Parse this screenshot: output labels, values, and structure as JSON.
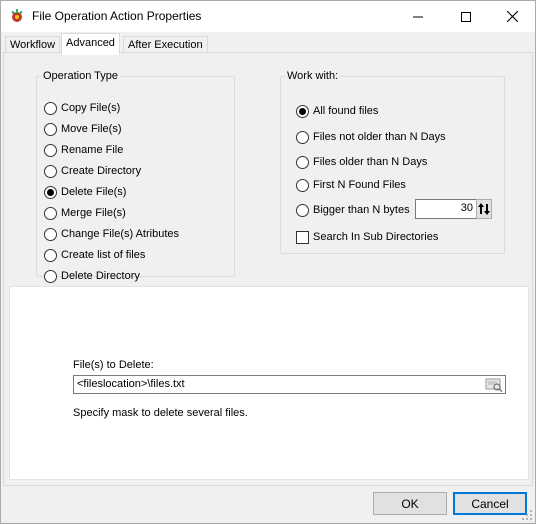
{
  "window": {
    "title": "File Operation Action Properties",
    "controls": {
      "minimize_icon": "minimize-icon",
      "maximize_icon": "maximize-icon",
      "close_icon": "close-icon"
    }
  },
  "tabs": [
    {
      "label": "Workflow",
      "active": false
    },
    {
      "label": "Advanced",
      "active": true
    },
    {
      "label": "After Execution",
      "active": false
    }
  ],
  "operation_type": {
    "legend": "Operation Type",
    "options": [
      {
        "label": "Copy File(s)",
        "checked": false
      },
      {
        "label": "Move File(s)",
        "checked": false
      },
      {
        "label": "Rename File",
        "checked": false
      },
      {
        "label": "Create Directory",
        "checked": false
      },
      {
        "label": "Delete File(s)",
        "checked": true
      },
      {
        "label": "Merge File(s)",
        "checked": false
      },
      {
        "label": "Change File(s) Atributes",
        "checked": false
      },
      {
        "label": "Create list of files",
        "checked": false
      },
      {
        "label": "Delete Directory",
        "checked": false
      }
    ]
  },
  "work_with": {
    "legend": "Work with:",
    "options": [
      {
        "label": "All found files",
        "checked": true
      },
      {
        "label": "Files not older than N Days",
        "checked": false
      },
      {
        "label": "Files older than N Days",
        "checked": false
      },
      {
        "label": "First N Found Files",
        "checked": false
      },
      {
        "label": "Bigger than N bytes",
        "checked": false
      }
    ],
    "bytes_value": "30",
    "subdirs_label": "Search In Sub Directories",
    "subdirs_checked": false
  },
  "delete_files": {
    "label": "File(s) to Delete:",
    "value": "<fileslocation>\\files.txt",
    "hint": "Specify mask to delete several files."
  },
  "buttons": {
    "ok": "OK",
    "cancel": "Cancel"
  },
  "colors": {
    "accent": "#0078d7",
    "panel": "#f0f0f0",
    "white": "#ffffff"
  }
}
